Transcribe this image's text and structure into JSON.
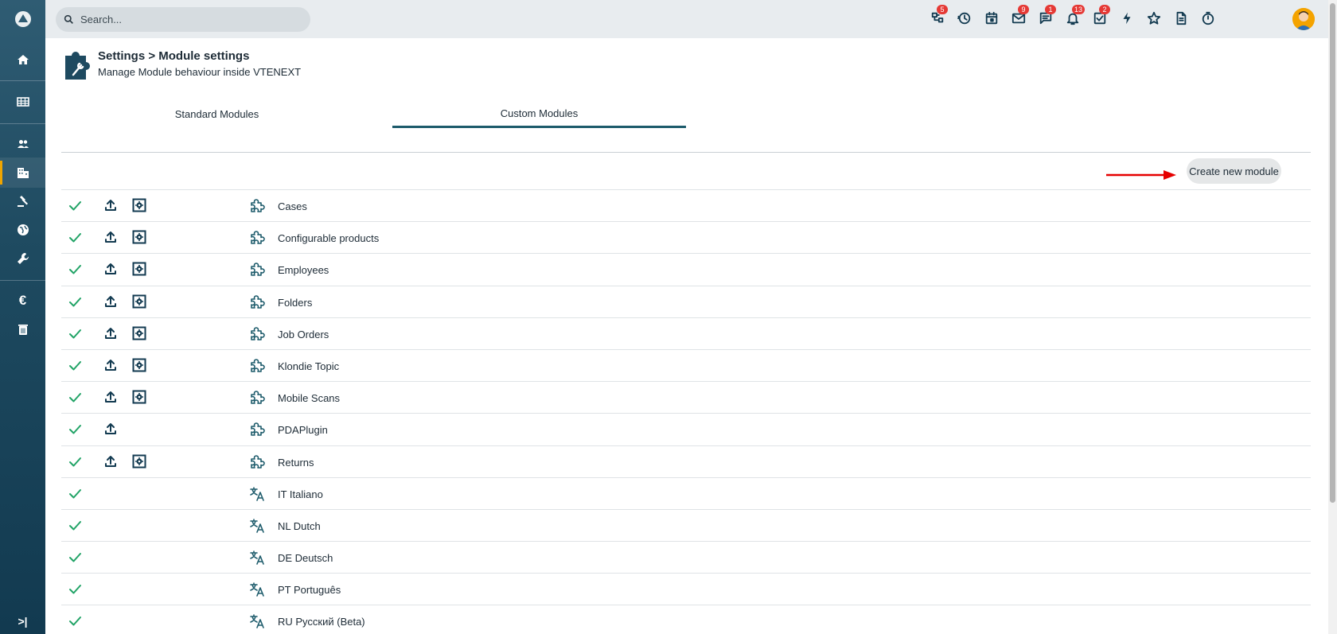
{
  "colors": {
    "accent": "#1d5b6b",
    "check": "#21a366",
    "badge": "#e53935",
    "sidebar_active": "#f0a500",
    "arrow": "#e60000"
  },
  "sidebar": {
    "items": [
      {
        "icon": "home-icon"
      },
      {
        "icon": "grid-icon"
      },
      {
        "icon": "users-icon"
      },
      {
        "icon": "building-icon",
        "active": true
      },
      {
        "icon": "gavel-icon"
      },
      {
        "icon": "globe-icon"
      },
      {
        "icon": "wrench-icon"
      },
      {
        "icon": "euro-icon",
        "glyph": "€"
      },
      {
        "icon": "trash-icon"
      }
    ],
    "expand_icon": "expand-sidebar-icon"
  },
  "topbar": {
    "search_placeholder": "Search...",
    "icons": [
      {
        "name": "processes-icon",
        "badge": "5"
      },
      {
        "name": "history-icon",
        "badge": ""
      },
      {
        "name": "calendar-icon",
        "badge": ""
      },
      {
        "name": "mail-icon",
        "badge": "9"
      },
      {
        "name": "chat-icon",
        "badge": "1"
      },
      {
        "name": "bell-icon",
        "badge": "13"
      },
      {
        "name": "tasks-icon",
        "badge": "2"
      },
      {
        "name": "bolt-icon",
        "badge": ""
      },
      {
        "name": "star-icon",
        "badge": ""
      },
      {
        "name": "document-icon",
        "badge": ""
      },
      {
        "name": "timer-icon",
        "badge": ""
      }
    ]
  },
  "header": {
    "title": "Settings > Module settings",
    "subtitle": "Manage Module behaviour inside VTENEXT"
  },
  "tabs": [
    {
      "label": "Standard Modules",
      "active": false
    },
    {
      "label": "Custom Modules",
      "active": true
    }
  ],
  "create_button": "Create new module",
  "modules": [
    {
      "name": "Cases",
      "type": "module",
      "upload": true,
      "config": true
    },
    {
      "name": "Configurable products",
      "type": "module",
      "upload": true,
      "config": true
    },
    {
      "name": "Employees",
      "type": "module",
      "upload": true,
      "config": true
    },
    {
      "name": "Folders",
      "type": "module",
      "upload": true,
      "config": true
    },
    {
      "name": "Job Orders",
      "type": "module",
      "upload": true,
      "config": true
    },
    {
      "name": "Klondie Topic",
      "type": "module",
      "upload": true,
      "config": true
    },
    {
      "name": "Mobile Scans",
      "type": "module",
      "upload": true,
      "config": true
    },
    {
      "name": "PDAPlugin",
      "type": "module",
      "upload": true,
      "config": false
    },
    {
      "name": "Returns",
      "type": "module",
      "upload": true,
      "config": true
    },
    {
      "name": "IT Italiano",
      "type": "language",
      "upload": false,
      "config": false
    },
    {
      "name": "NL Dutch",
      "type": "language",
      "upload": false,
      "config": false
    },
    {
      "name": "DE Deutsch",
      "type": "language",
      "upload": false,
      "config": false
    },
    {
      "name": "PT Português",
      "type": "language",
      "upload": false,
      "config": false
    },
    {
      "name": "RU Русский (Beta)",
      "type": "language",
      "upload": false,
      "config": false
    }
  ]
}
